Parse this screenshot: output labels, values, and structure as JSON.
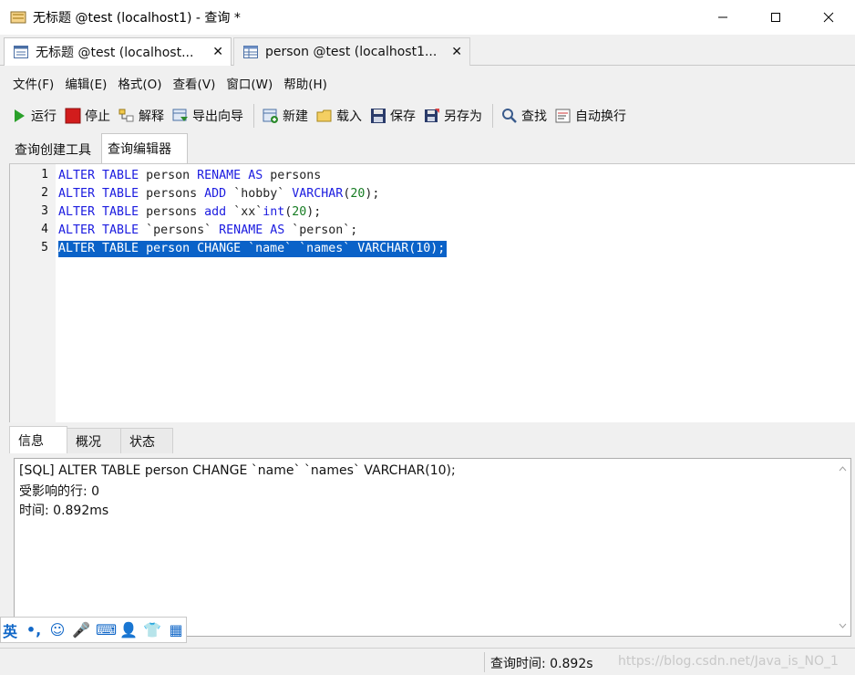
{
  "window": {
    "title": "无标题 @test (localhost1) - 查询 *",
    "minimize": "—",
    "maximize": "☐",
    "close": "✕"
  },
  "doc_tabs": [
    {
      "label": "无标题 @test (localhost...",
      "close": "✕"
    },
    {
      "label": "person @test (localhost1...",
      "close": "✕"
    }
  ],
  "menu": [
    "文件(F)",
    "编辑(E)",
    "格式(O)",
    "查看(V)",
    "窗口(W)",
    "帮助(H)"
  ],
  "toolbar": {
    "run": "运行",
    "stop": "停止",
    "explain": "解释",
    "export": "导出向导",
    "new": "新建",
    "load": "载入",
    "save": "保存",
    "save_as": "另存为",
    "find": "查找",
    "wrap": "自动换行"
  },
  "sub_tabs": [
    "查询创建工具",
    "查询编辑器"
  ],
  "editor": {
    "line_numbers": [
      "1",
      "2",
      "3",
      "4",
      "5"
    ]
  },
  "result_tabs": [
    "信息",
    "概况",
    "状态"
  ],
  "info": {
    "line1": "[SQL] ALTER TABLE person CHANGE `name` `names` VARCHAR(10);",
    "line2": "受影响的行: 0",
    "line3": "时间: 0.892ms"
  },
  "ime": [
    "英",
    "•,",
    "☺",
    "🎤",
    "⌨",
    "👤",
    "👕",
    "▦"
  ],
  "status": {
    "query_time": "查询时间: 0.892s",
    "watermark": "https://blog.csdn.net/Java_is_NO_1"
  },
  "colors": {
    "keyword": "#1c1ce0",
    "number": "#167c22",
    "selection": "#0a62c8"
  }
}
